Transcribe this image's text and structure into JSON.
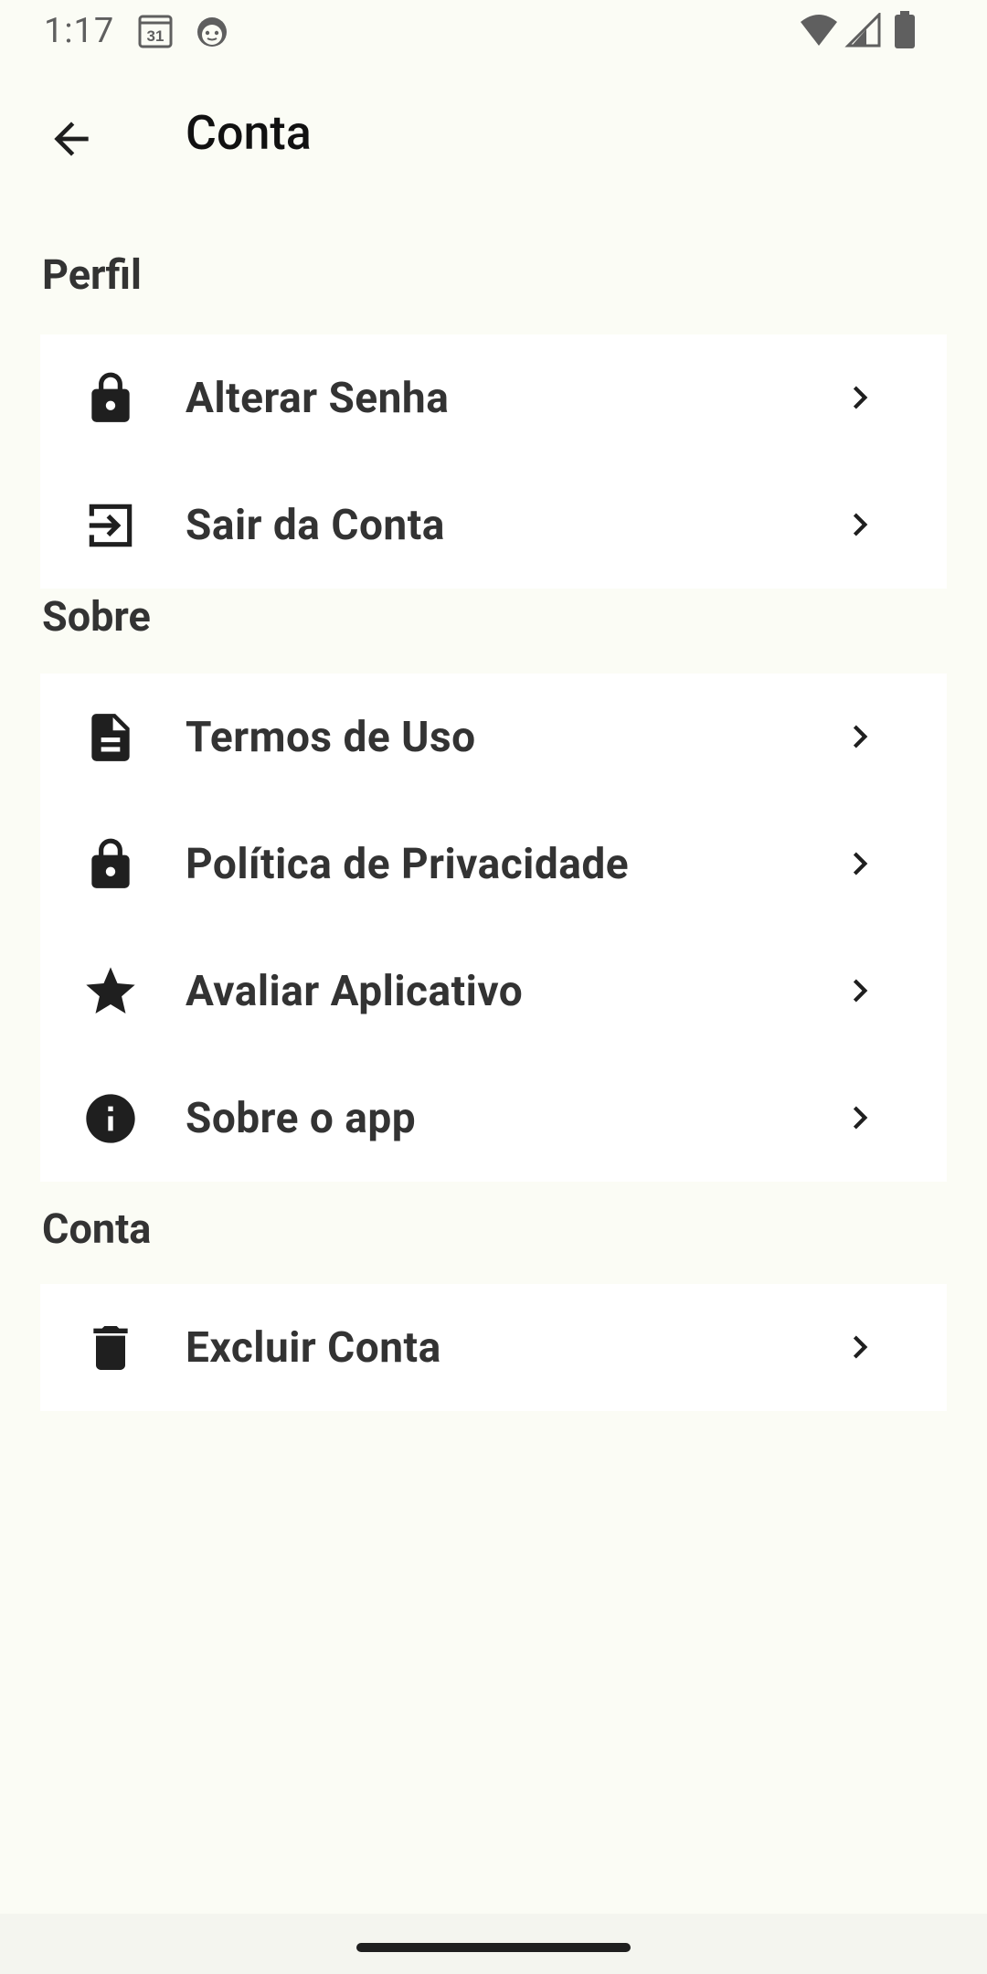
{
  "status_bar": {
    "time": "1:17",
    "calendar_day": "31",
    "icons": [
      "calendar-icon",
      "face-icon",
      "wifi-icon",
      "signal-icon",
      "battery-icon"
    ]
  },
  "app_bar": {
    "title": "Conta",
    "back_icon": "arrow-back-icon"
  },
  "sections": {
    "profile": {
      "title": "Perfil",
      "items": [
        {
          "label": "Alterar Senha",
          "icon": "lock-icon"
        },
        {
          "label": "Sair da Conta",
          "icon": "logout-icon"
        }
      ]
    },
    "about": {
      "title": "Sobre",
      "items": [
        {
          "label": "Termos de Uso",
          "icon": "document-icon"
        },
        {
          "label": "Política de Privacidade",
          "icon": "lock-icon"
        },
        {
          "label": "Avaliar Aplicativo",
          "icon": "star-icon"
        },
        {
          "label": "Sobre o app",
          "icon": "info-icon"
        }
      ]
    },
    "account": {
      "title": "Conta",
      "items": [
        {
          "label": "Excluir Conta",
          "icon": "trash-icon"
        }
      ]
    }
  },
  "colors": {
    "background": "#fbfcf5",
    "card": "#ffffff",
    "text": "#333333",
    "icon": "#1f1f1f"
  }
}
